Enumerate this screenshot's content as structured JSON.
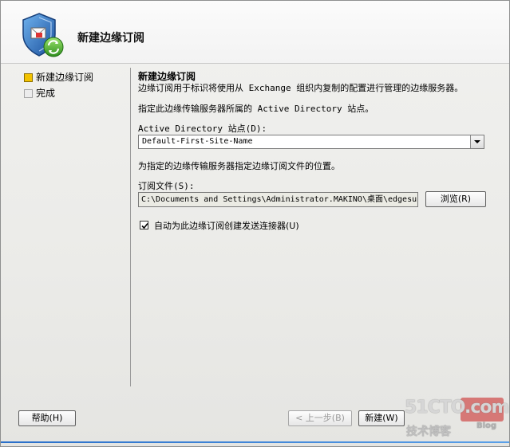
{
  "header": {
    "title": "新建边缘订阅",
    "icon": "shield-sync-icon"
  },
  "nav": {
    "items": [
      {
        "label": "新建边缘订阅",
        "state": "active"
      },
      {
        "label": "完成",
        "state": "pending"
      }
    ]
  },
  "content": {
    "section_title": "新建边缘订阅",
    "description": "边缘订阅用于标识将使用从 Exchange 组织内复制的配置进行管理的边缘服务器。",
    "site_instruction": "指定此边缘传输服务器所属的 Active Directory 站点。",
    "site_label": "Active Directory 站点(D):",
    "site_value": "Default-First-Site-Name",
    "file_instruction": "为指定的边缘传输服务器指定边缘订阅文件的位置。",
    "file_label": "订阅文件(S):",
    "file_value": "C:\\Documents and Settings\\Administrator.MAKINO\\桌面\\edgesu",
    "browse_label": "浏览(R)",
    "checkbox_label": "自动为此边缘订阅创建发送连接器(U)",
    "checkbox_checked": true
  },
  "footer": {
    "help_label": "帮助(H)",
    "back_label": "< 上一步(B)",
    "new_label": "新建(W)"
  },
  "watermark": {
    "main": "51CTO.com",
    "sub": "技术博客",
    "blog": "Blog"
  }
}
